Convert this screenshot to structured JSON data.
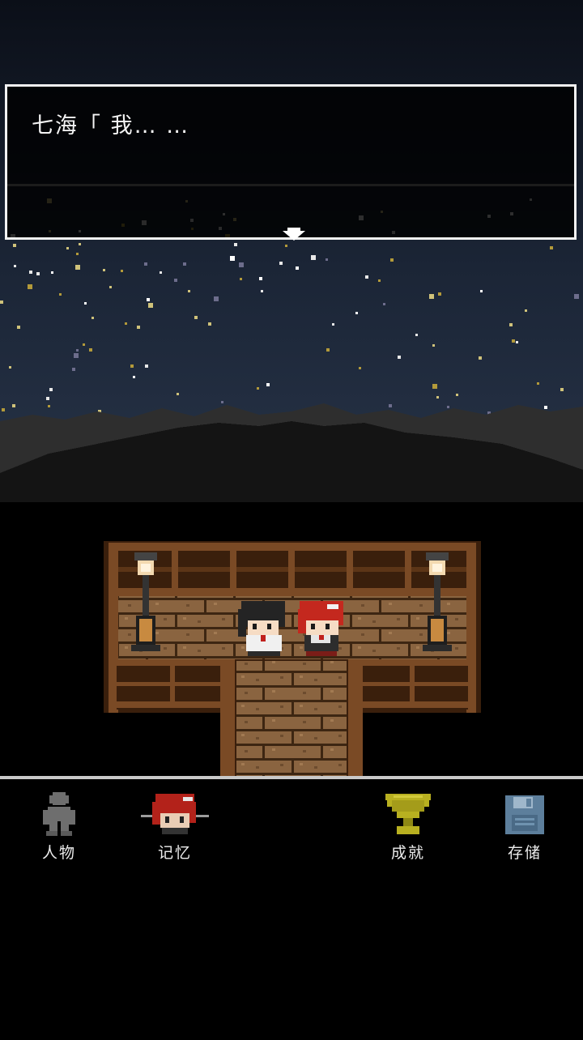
{
  "dialog": {
    "text": "七海「 我… …"
  },
  "menu": {
    "characters_label": "人物",
    "memories_label": "记忆",
    "achievements_label": "成就",
    "save_label": "存储"
  },
  "colors": {
    "sky": "#1d2738",
    "mountains": "#2f2f2f",
    "wood": "#6b3d1d",
    "trophy": "#b8b020",
    "floppy": "#5d7f9c"
  }
}
